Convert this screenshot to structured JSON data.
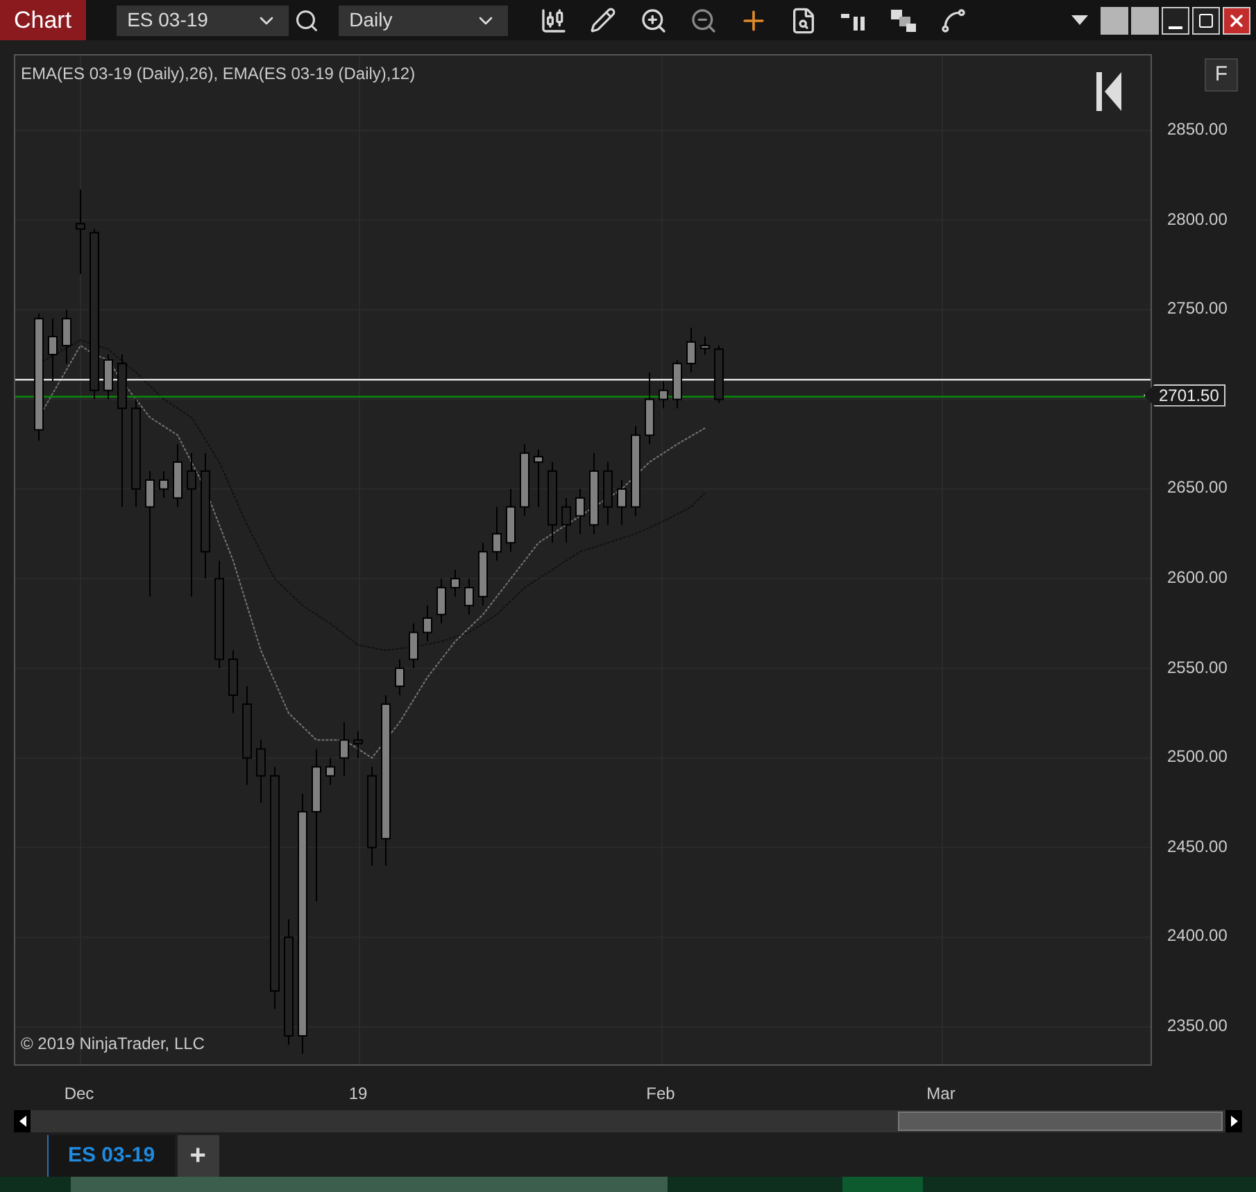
{
  "toolbar": {
    "title": "Chart",
    "instrument": "ES 03-19",
    "interval": "Daily"
  },
  "chart": {
    "legend": "EMA(ES 03-19 (Daily),26), EMA(ES 03-19 (Daily),12)",
    "panel_button": "F",
    "copyright": "© 2019 NinjaTrader, LLC",
    "price_marker": "2701.50",
    "y_axis_labels": [
      "2850.00",
      "2800.00",
      "2750.00",
      "2650.00",
      "2600.00",
      "2550.00",
      "2500.00",
      "2450.00",
      "2400.00",
      "2350.00"
    ],
    "x_axis_labels": [
      "Dec",
      "19",
      "Feb",
      "Mar"
    ]
  },
  "tabs": [
    {
      "label": "ES 03-19",
      "selected": true
    }
  ],
  "add_tab": "+"
}
